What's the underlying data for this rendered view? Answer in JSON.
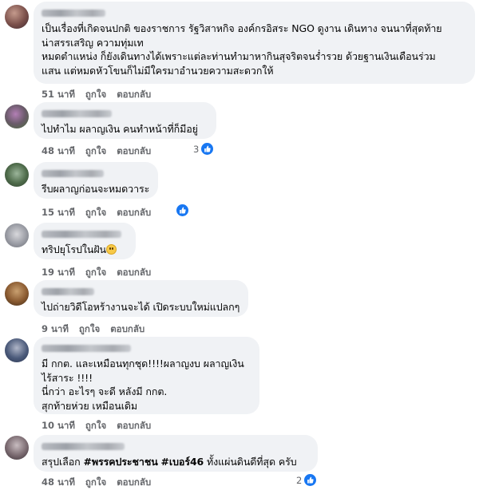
{
  "actions": {
    "like_label": "ถูกใจ",
    "reply_label": "ตอบกลับ"
  },
  "comments": [
    {
      "text": "เป็นเรื่องที่เกิดจนปกติ ของราชการ รัฐวิสาหกิจ องค์กรอิสระ NGO ดูงาน เดินทาง จนนาที่สุดท้าย\nน่าสรรเสริญ ความทุ่มเท\nหมดตำแหน่ง ก็ยังเดินทางได้เพราะแต่ละท่านทำมาหากินสุจริตจนร่ำรวย ด้วยฐานเงินเดือนร่วม\nแสน แต่หมดหัวโขนก็ไม่มีใครมาอำนวยความสะดวกให้",
      "time": "51 นาที"
    },
    {
      "text": "ไปทำไม ผลาญเงิน คนทำหน้าที่ก็มีอยู่",
      "time": "48 นาที",
      "reaction_count": "3"
    },
    {
      "text": "รีบผลาญก่อนจะหมดวาระ",
      "time": "15 นาที",
      "reaction_count": ""
    },
    {
      "text": "ทริปยุโรปในฝัน",
      "time": "19 นาที"
    },
    {
      "text": "ไปถ่ายวิดีโอหร้างานจะได้ เปิดระบบใหม่แปลกๆ",
      "time": "9 นาที"
    },
    {
      "text": "มี กกต. และเหมือนทุกชุด!!!!ผลาญงบ ผลาญเงิน\nไร้สาระ !!!!\nนี่กว่า อะไรๆ จะดี หลังมี กกต.\nสุกท้ายห่วย เหมือนเดิม",
      "time": "10 นาที"
    },
    {
      "text_pre": "สรุปเลือก ",
      "hashtag1": "#พรรคประชาชน",
      "hashtag2": "#เบอร์46",
      "text_post": " ทั้งแผ่นดินดีที่สุด ครับ",
      "time": "48 นาที",
      "reaction_count": "2"
    }
  ],
  "colors": {
    "bubble": "#f0f2f5",
    "meta": "#65676b",
    "like_blue": "#1877f2"
  },
  "icons": [
    "like-icon",
    "grimace-emoji"
  ]
}
